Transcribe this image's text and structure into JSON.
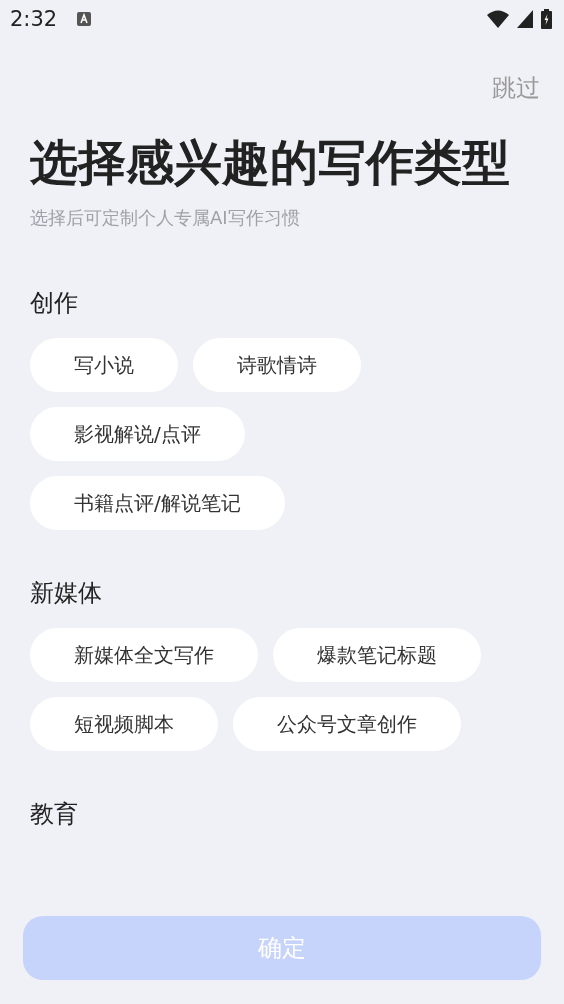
{
  "status_bar": {
    "time": "2:32"
  },
  "skip": "跳过",
  "title": "选择感兴趣的写作类型",
  "subtitle": "选择后可定制个人专属AI写作习惯",
  "sections": [
    {
      "heading": "创作",
      "chips": [
        {
          "label": "写小说",
          "selected": false
        },
        {
          "label": "诗歌情诗",
          "selected": false
        },
        {
          "label": "影视解说/点评",
          "selected": false
        },
        {
          "label": "书籍点评/解说笔记",
          "selected": false
        }
      ]
    },
    {
      "heading": "新媒体",
      "chips": [
        {
          "label": "新媒体全文写作",
          "selected": false
        },
        {
          "label": "爆款笔记标题",
          "selected": false
        },
        {
          "label": "短视频脚本",
          "selected": false
        },
        {
          "label": "公众号文章创作",
          "selected": false
        }
      ]
    },
    {
      "heading": "教育"
    }
  ],
  "confirm": {
    "label": "确定",
    "disabled": true
  }
}
